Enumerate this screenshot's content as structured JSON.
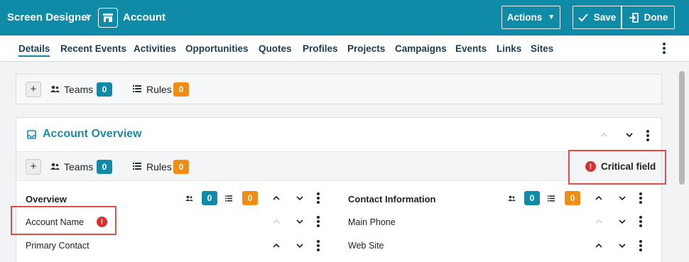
{
  "topbar": {
    "breadcrumb": "Screen Designer",
    "title": "Account",
    "actions_label": "Actions",
    "save_label": "Save",
    "done_label": "Done"
  },
  "tabs": [
    "Details",
    "Recent Events",
    "Activities",
    "Opportunities",
    "Quotes",
    "Profiles",
    "Projects",
    "Campaigns",
    "Events",
    "Links",
    "Sites"
  ],
  "top_panel": {
    "teams_label": "Teams",
    "teams_count": "0",
    "rules_label": "Rules",
    "rules_count": "0"
  },
  "overview": {
    "title": "Account Overview",
    "teams_label": "Teams",
    "teams_count": "0",
    "rules_label": "Rules",
    "rules_count": "0",
    "critical_label": "Critical field",
    "left_section": {
      "title": "Overview",
      "teams_count": "0",
      "rules_count": "0",
      "fields": [
        "Account Name",
        "Primary Contact"
      ]
    },
    "right_section": {
      "title": "Contact Information",
      "teams_count": "0",
      "rules_count": "0",
      "fields": [
        "Main Phone",
        "Web Site"
      ]
    }
  },
  "colors": {
    "brand": "#0f8aa7",
    "teal_badge": "#0f8aa7",
    "orange_badge": "#f28c12",
    "critical": "#d92f2f",
    "highlight": "#e04b4b"
  }
}
